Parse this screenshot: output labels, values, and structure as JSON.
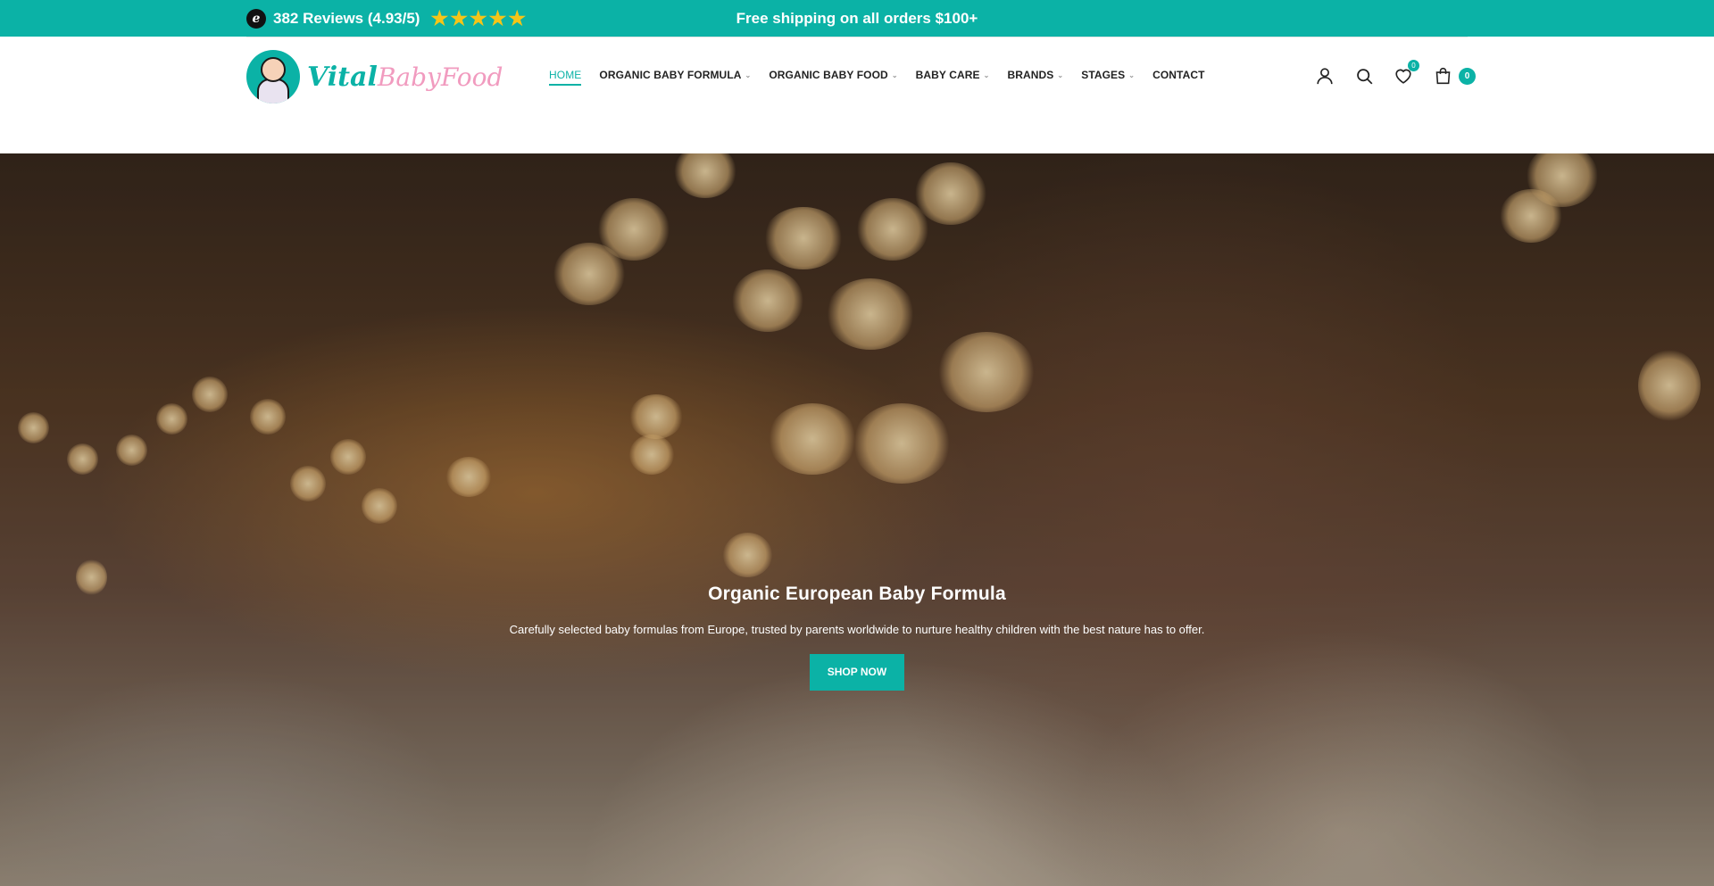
{
  "topbar": {
    "review_logo_letter": "e",
    "reviews_text": "382 Reviews (4.93/5)",
    "star_count": 5,
    "shipping_text": "Free shipping on all orders $100+",
    "bg_color": "#0bb2a6"
  },
  "header": {
    "logo": {
      "word1": "Vital",
      "word2": "BabyFood"
    },
    "nav": [
      {
        "label": "HOME",
        "active": true,
        "has_dropdown": false
      },
      {
        "label": "ORGANIC BABY FORMULA",
        "active": false,
        "has_dropdown": true
      },
      {
        "label": "ORGANIC BABY FOOD",
        "active": false,
        "has_dropdown": true
      },
      {
        "label": "BABY CARE",
        "active": false,
        "has_dropdown": true
      },
      {
        "label": "BRANDS",
        "active": false,
        "has_dropdown": true
      },
      {
        "label": "STAGES",
        "active": false,
        "has_dropdown": true
      },
      {
        "label": "CONTACT",
        "active": false,
        "has_dropdown": false
      }
    ],
    "icons": {
      "account": "user-icon",
      "search": "search-icon",
      "wishlist": "heart-icon",
      "wishlist_count": "0",
      "cart": "shopping-bag-icon",
      "cart_count": "0"
    }
  },
  "hero": {
    "title": "Organic European Baby Formula",
    "subtitle": "Carefully selected baby formulas from Europe, trusted by parents worldwide to nurture healthy children with the best nature has to offer.",
    "button_label": "SHOP NOW"
  },
  "colors": {
    "accent": "#0bb2a6",
    "logo_pink": "#f19bbf",
    "star": "#f5c518"
  }
}
